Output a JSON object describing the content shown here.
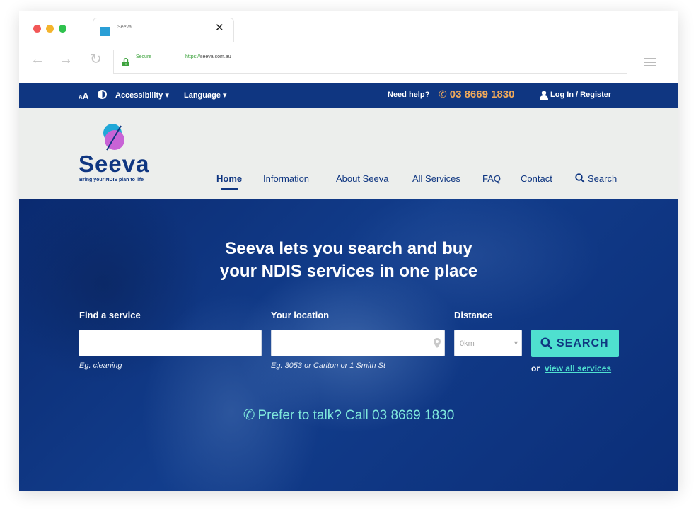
{
  "browser": {
    "tab_title": "Seeva",
    "tab_close": "✕",
    "secure_label": "Secure",
    "url_scheme": "https://",
    "url_rest": "seeva.com.au",
    "back": "←",
    "forward": "→",
    "reload": "↻"
  },
  "topbar": {
    "text_size_small": "A",
    "text_size_big": "A",
    "accessibility": "Accessibility ▾",
    "language": "Language ▾",
    "need_help": "Need help?",
    "phone": "03 8669 1830",
    "login": "Log In / Register"
  },
  "header": {
    "logo_text": "Seeva",
    "tagline": "Bring your NDIS plan to life",
    "nav": [
      "Home",
      "Information",
      "About Seeva",
      "All Services",
      "FAQ",
      "Contact",
      "Search"
    ]
  },
  "hero": {
    "title_line1": "Seeva lets you search and buy",
    "title_line2": "your NDIS services in one place",
    "find_label": "Find a service",
    "find_hint": "Eg. cleaning",
    "find_value": "",
    "location_label": "Your location",
    "location_hint": "Eg. 3053 or Carlton or 1 Smith St",
    "location_value": "",
    "distance_label": "Distance",
    "distance_value": "0km",
    "search_button": "SEARCH",
    "or": "or",
    "view_all": "view all services",
    "talk_text": "Prefer to talk? Call 03 8669 1830"
  },
  "colors": {
    "brand_navy": "#0f3681",
    "accent_teal": "#4fe0cf",
    "phone_orange": "#f0a95a",
    "header_bg": "#eceeec"
  }
}
